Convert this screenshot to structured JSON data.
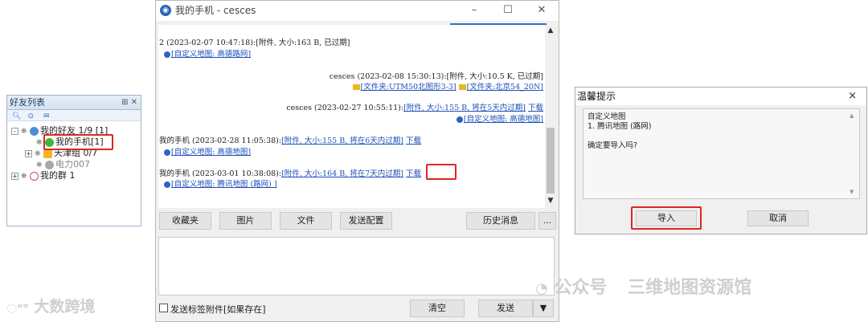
{
  "friends_panel": {
    "title": "好友列表",
    "title_controls": "⊞ ✕",
    "toolbar_icons": [
      "search-icon",
      "refresh-icon",
      "mail-icon"
    ],
    "items": [
      {
        "label": "我的好友 1/9 [1]",
        "expander": "-"
      },
      {
        "label": "我的手机[1]",
        "expander": ""
      },
      {
        "label": "天津组 0/7",
        "expander": "+"
      },
      {
        "label": "电力007",
        "expander": ""
      },
      {
        "label": "我的群 1",
        "expander": "+"
      }
    ]
  },
  "chat": {
    "window_title": "我的手机 - cesces",
    "controls": {
      "minimize": "–",
      "maximize": "☐",
      "close": "✕"
    },
    "messages": [
      {
        "header": "2 (2023-02-07 10:47:18):[附件, 大小:163 B, 已过期]",
        "link": "[自定义地图: 高德路网]"
      },
      {
        "header": "cesces (2023-02-08 15:30:13):[附件, 大小:10.5 K, 已过期]",
        "folders": [
          "[文件夹:UTM50北图形3-3]",
          "[文件夹:北京54_20N]"
        ]
      },
      {
        "header_prefix": "cesces (2023-02-27 10:55:11):",
        "header_link": "[附件, 大小:155 B, 将在5天内过期]",
        "download": "下载",
        "link": "[自定义地图: 高德地图]"
      },
      {
        "header_prefix": "我的手机 (2023-02-28 11:05:38):",
        "header_link": "[附件, 大小:155 B, 将在6天内过期]",
        "download": "下载",
        "link": "[自定义地图: 高德地图]"
      },
      {
        "header_prefix": "我的手机 (2023-03-01 10:38:08):",
        "header_link": "[附件, 大小:164 B, 将在7天内过期]",
        "download": "下载",
        "link": "[自定义地图: 腾讯地图 (路网) ]"
      }
    ],
    "toolbar": {
      "favorites": "收藏夹",
      "picture": "图片",
      "file": "文件",
      "send_config": "发送配置",
      "history": "历史消息",
      "more": "..."
    },
    "send_attach_checkbox": "发送标签附件[如果存在]",
    "clear": "清空",
    "send": "发送",
    "send_dropdown": "▼"
  },
  "dialog": {
    "title": "温馨提示",
    "close": "×",
    "message_lines": [
      "自定义地图",
      "1. 腾讯地图 (路网)",
      "",
      "确定要导入吗?"
    ],
    "ok": "导入",
    "cancel": "取消"
  },
  "watermarks": {
    "left": "大数跨境",
    "right_brand": "公众号",
    "right_name": "三维地图资源馆"
  },
  "colors": {
    "highlight_red": "#e02424",
    "link_blue": "#1b4fb8",
    "accent_blue": "#2b74c9"
  }
}
